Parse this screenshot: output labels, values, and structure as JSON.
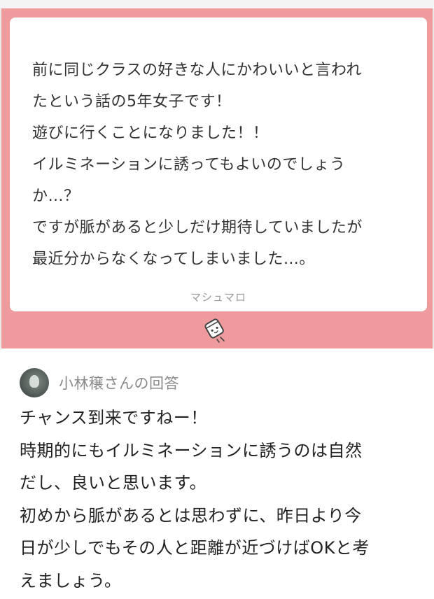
{
  "question": {
    "lines": [
      "前に同じクラスの好きな人にかわいいと言われ",
      "たという話の5年女子です！",
      "遊びに行くことになりました！！",
      "イルミネーションに誘ってもよいのでしょう",
      "か…？",
      "ですが脈があると少しだけ期待していましたが",
      "最近分からなくなってしまいました…。"
    ],
    "brand": "マシュマロ",
    "icon": "marshmallow-icon"
  },
  "answer": {
    "answerer_label": "小林穣さんの回答",
    "avatar": "avatar",
    "lines": [
      "チャンス到来ですねー！",
      "時期的にもイルミネーションに誘うのは自然",
      "だし、良いと思います。",
      "初めから脈があるとは思わずに、昨日より今",
      "日が少しでもその人と距離が近づけばOKと考",
      "えましょう。"
    ]
  },
  "colors": {
    "panel_pink": "#ef9a9c",
    "card_white": "#ffffff",
    "text_dark": "#222222",
    "text_gray": "#8a8a8a"
  }
}
